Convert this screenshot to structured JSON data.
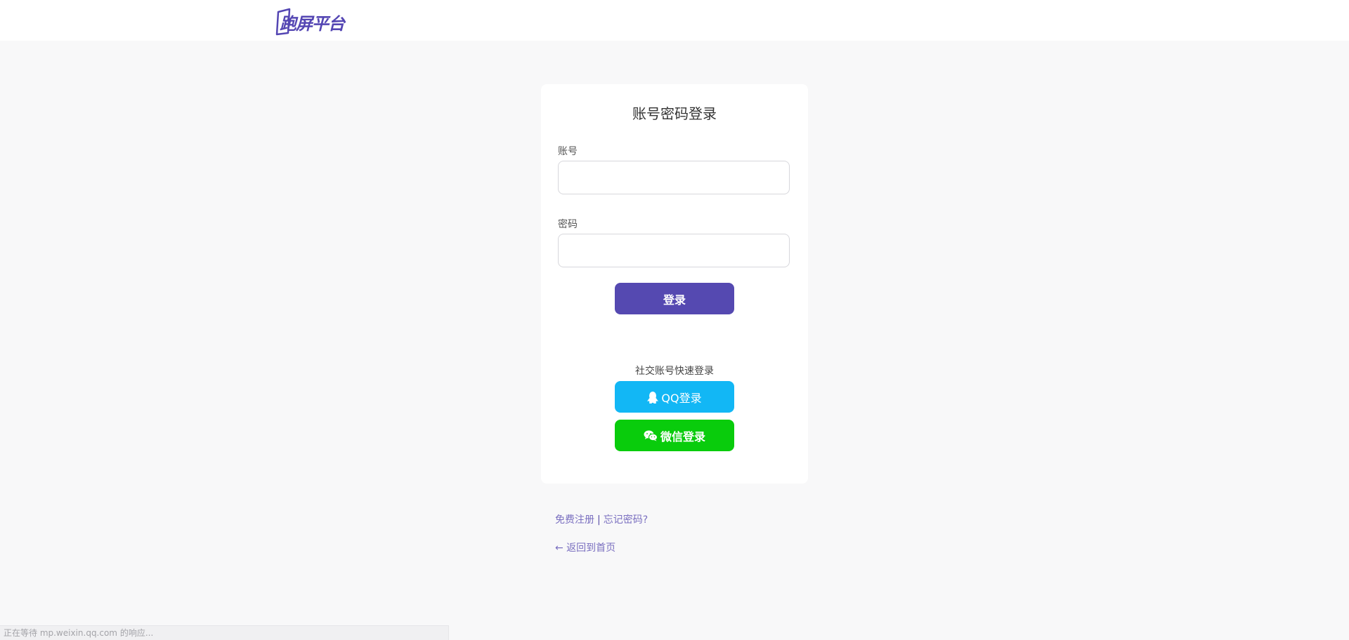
{
  "brand": {
    "logo_text": "跑屏平台",
    "accent_color": "#5446b3"
  },
  "login_card": {
    "title": "账号密码登录",
    "account_label": "账号",
    "account_value": "",
    "password_label": "密码",
    "password_value": "",
    "login_button": "登录",
    "login_button_color": "#5549b1"
  },
  "social": {
    "caption": "社交账号快速登录",
    "qq_button": "QQ登录",
    "qq_icon": "qq-penguin-icon",
    "qq_color": "#12b7f5",
    "wechat_button": "微信登录",
    "wechat_icon": "wechat-icon",
    "wechat_color": "#09cc0c"
  },
  "footer_links": {
    "register": "免费注册",
    "separator": "|",
    "forgot": "忘记密码?",
    "back_home": "← 返回到首页"
  },
  "status_bar": {
    "text": "正在等待 mp.weixin.qq.com 的响应..."
  }
}
